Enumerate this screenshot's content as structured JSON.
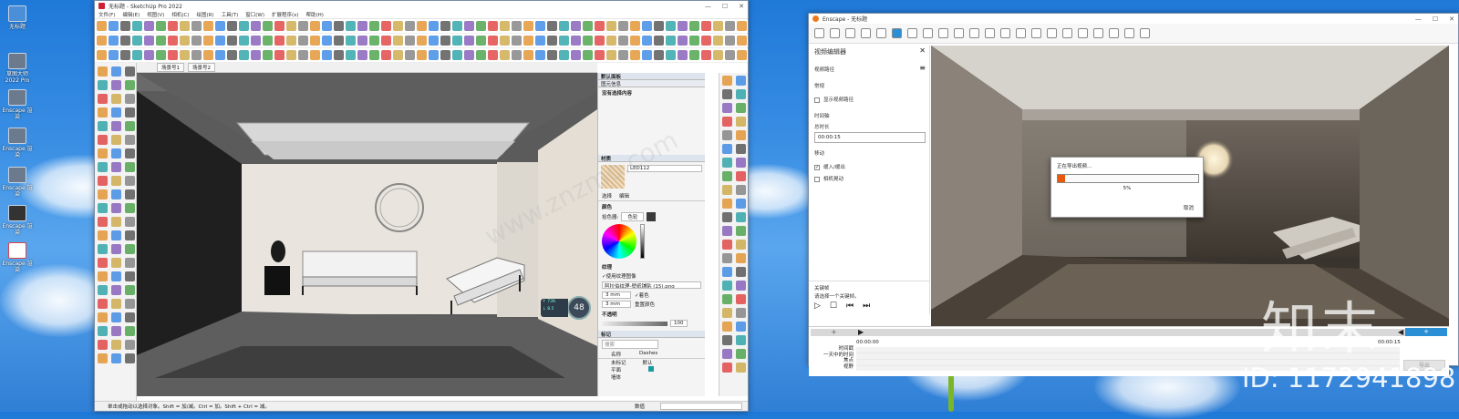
{
  "desktop": {
    "icons": [
      "无标题",
      "草图大师 2022 Pro",
      "Enscape 渲染",
      "Enscape 渲染",
      "Enscape 渲染",
      "Enscape 渲染",
      "Enscape 渲染"
    ],
    "watermark_logo": "知末",
    "watermark_id": "ID: 1172941898",
    "watermark_site": "www.znzmo.com"
  },
  "sketchup": {
    "title": "无标题 - SketchUp Pro 2022",
    "menu": [
      "文件(F)",
      "编辑(E)",
      "视图(V)",
      "相机(C)",
      "绘图(R)",
      "工具(T)",
      "窗口(W)",
      "扩展程序(x)",
      "帮助(H)"
    ],
    "scene_tabs": [
      "场景号1",
      "场景号2"
    ],
    "tray": {
      "default_tray": "默认面板",
      "entity_info": "图元信息",
      "no_selection": "没有选择内容",
      "materials": "材质",
      "material_name": "LED112",
      "tab_select": "选择",
      "tab_edit": "编辑",
      "color": "颜色",
      "picker_label": "拾色器:",
      "picker_value": "色轮",
      "texture": "纹理",
      "use_texture": "使用纹理图像",
      "texture_file": "阿拉伯纹理-壁纸铺贴 (15).png",
      "width": "3 mm",
      "height": "3 mm",
      "colorize": "着色",
      "reset_color": "重置颜色",
      "opacity": "不透明",
      "opacity_value": "100",
      "tags": "标记",
      "search_placeholder": "搜索",
      "col_name": "名称",
      "col_dashes": "Dashes",
      "tag_rows": [
        {
          "name": "未标记",
          "dash": "默认"
        },
        {
          "name": "平面",
          "dash": ""
        },
        {
          "name": "墙体",
          "dash": ""
        }
      ]
    },
    "speed_badge": "48",
    "speed_up": "↑ 739.",
    "speed_down": "↓ 8.5",
    "status_text": "单击或拖动以选择对象。Shift = 加/减。Ctrl = 加。Shift + Ctrl = 减。",
    "measurements_label": "数值"
  },
  "enscape": {
    "title": "Enscape - 无标题",
    "panel_title": "视频编辑器",
    "video_path": "视频路径",
    "regular": "常规",
    "show_path": "显示视频路径",
    "timeline": "时间轴",
    "total_duration": "总时长",
    "duration_value": "00:00:15",
    "movement": "移动",
    "ease_in_out": "缓入/缓出",
    "camera_shake": "相机晃动",
    "keyframe": "关键帧",
    "keyframe_hint": "请选择一个关键帧。",
    "export_dialog": {
      "title": "正在导出视频...",
      "progress": 0.05,
      "progress_text": "5%",
      "cancel": "取消"
    },
    "time_start": "00:00:00",
    "time_end": "00:00:15",
    "track_labels": [
      "时间戳",
      "一天中的时间",
      "焦点",
      "视野"
    ],
    "export_button": "导出",
    "add_button": "+"
  },
  "colors": {
    "accent_orange": "#e8590c",
    "enscape_blue": "#2b8fd6",
    "sketchup_tray_header": "#dde4ee"
  }
}
